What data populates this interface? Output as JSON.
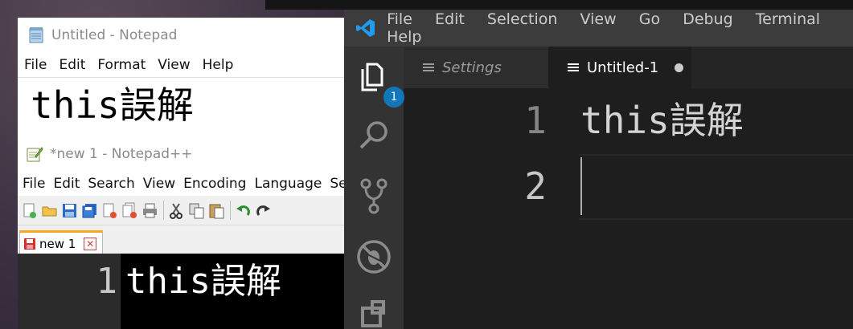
{
  "notepad": {
    "title": "Untitled - Notepad",
    "menu": [
      "File",
      "Edit",
      "Format",
      "View",
      "Help"
    ],
    "content": "this誤解"
  },
  "notepadpp": {
    "title": "*new 1 - Notepad++",
    "menu": [
      "File",
      "Edit",
      "Search",
      "View",
      "Encoding",
      "Language",
      "Se"
    ],
    "tab_label": "new 1",
    "line_number": "1",
    "content": "this誤解"
  },
  "vscode": {
    "menu": [
      "File",
      "Edit",
      "Selection",
      "View",
      "Go",
      "Debug",
      "Terminal",
      "Help"
    ],
    "explorer_badge": "1",
    "tabs": [
      {
        "label": "Settings",
        "active": false
      },
      {
        "label": "Untitled-1",
        "active": true,
        "dirty": true
      }
    ],
    "lines": [
      {
        "number": "1",
        "text": "this誤解"
      },
      {
        "number": "2",
        "text": ""
      }
    ]
  },
  "icons": {
    "notepad": "notepad-icon",
    "notepadpp": "notepadpp-icon",
    "vscode": "vscode-logo-icon",
    "explorer": "files-icon",
    "search": "search-icon",
    "source_control": "source-control-icon",
    "debug": "debug-icon",
    "extensions": "extensions-icon"
  },
  "colors": {
    "vscode_titlebar": "#3c3c3c",
    "vscode_activity": "#333333",
    "vscode_editor": "#1e1e1e",
    "vscode_badge": "#1177bb",
    "npp_tab_accent": "#fba71c",
    "npp_editor_bg": "#000000"
  }
}
